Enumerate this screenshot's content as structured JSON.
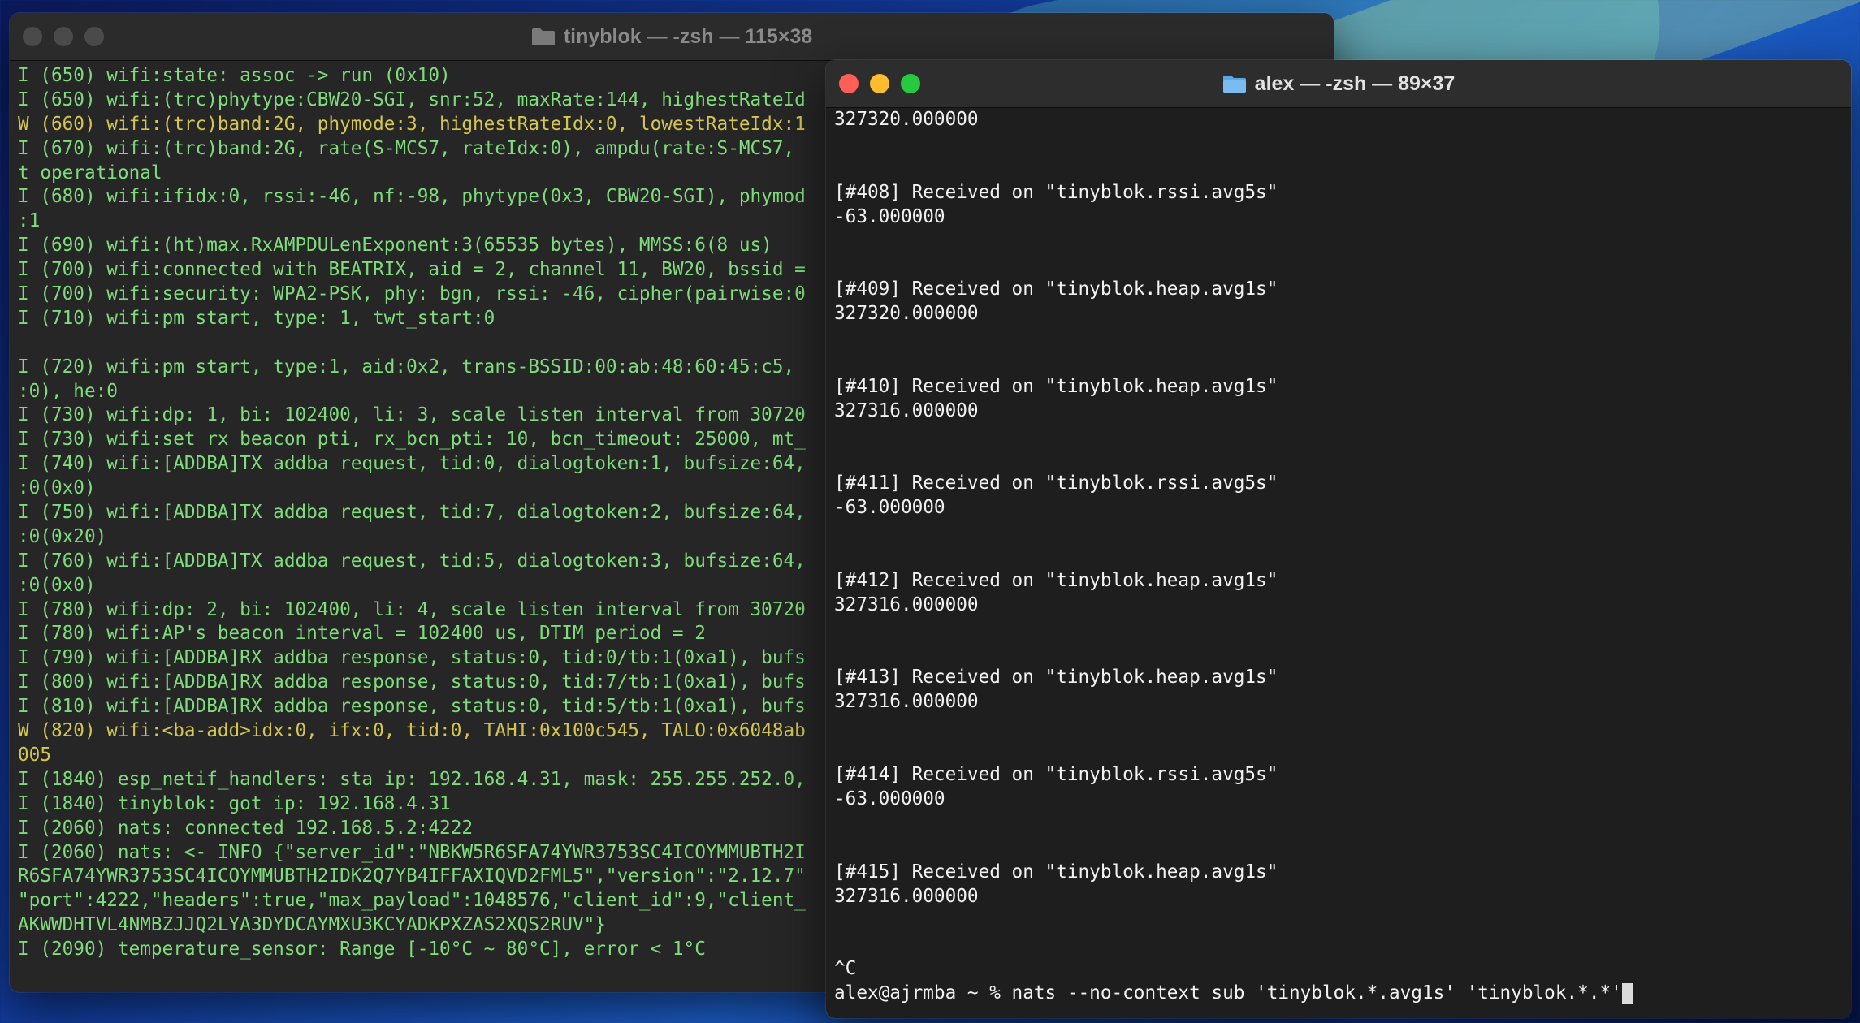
{
  "left_window": {
    "title": "tinyblok — -zsh — 115×38",
    "lines": [
      {
        "text": "I (650) wifi:state: assoc -> run (0x10)",
        "level": "I"
      },
      {
        "text": "I (650) wifi:(trc)phytype:CBW20-SGI, snr:52, maxRate:144, highestRateId",
        "level": "I"
      },
      {
        "text": "W (660) wifi:(trc)band:2G, phymode:3, highestRateIdx:0, lowestRateIdx:1",
        "level": "W"
      },
      {
        "text": "I (670) wifi:(trc)band:2G, rate(S-MCS7, rateIdx:0), ampdu(rate:S-MCS7,",
        "level": "I"
      },
      {
        "text": "t operational",
        "level": "I"
      },
      {
        "text": "I (680) wifi:ifidx:0, rssi:-46, nf:-98, phytype(0x3, CBW20-SGI), phymod",
        "level": "I"
      },
      {
        "text": ":1",
        "level": "I"
      },
      {
        "text": "I (690) wifi:(ht)max.RxAMPDULenExponent:3(65535 bytes), MMSS:6(8 us)",
        "level": "I"
      },
      {
        "text": "I (700) wifi:connected with BEATRIX, aid = 2, channel 11, BW20, bssid =",
        "level": "I"
      },
      {
        "text": "I (700) wifi:security: WPA2-PSK, phy: bgn, rssi: -46, cipher(pairwise:0",
        "level": "I"
      },
      {
        "text": "I (710) wifi:pm start, type: 1, twt_start:0",
        "level": "I"
      },
      {
        "text": "",
        "level": "I"
      },
      {
        "text": "I (720) wifi:pm start, type:1, aid:0x2, trans-BSSID:00:ab:48:60:45:c5,",
        "level": "I"
      },
      {
        "text": ":0), he:0",
        "level": "I"
      },
      {
        "text": "I (730) wifi:dp: 1, bi: 102400, li: 3, scale listen interval from 30720",
        "level": "I"
      },
      {
        "text": "I (730) wifi:set rx beacon pti, rx_bcn_pti: 10, bcn_timeout: 25000, mt_",
        "level": "I"
      },
      {
        "text": "I (740) wifi:[ADDBA]TX addba request, tid:0, dialogtoken:1, bufsize:64,",
        "level": "I"
      },
      {
        "text": ":0(0x0)",
        "level": "I"
      },
      {
        "text": "I (750) wifi:[ADDBA]TX addba request, tid:7, dialogtoken:2, bufsize:64,",
        "level": "I"
      },
      {
        "text": ":0(0x20)",
        "level": "I"
      },
      {
        "text": "I (760) wifi:[ADDBA]TX addba request, tid:5, dialogtoken:3, bufsize:64,",
        "level": "I"
      },
      {
        "text": ":0(0x0)",
        "level": "I"
      },
      {
        "text": "I (780) wifi:dp: 2, bi: 102400, li: 4, scale listen interval from 30720",
        "level": "I"
      },
      {
        "text": "I (780) wifi:AP's beacon interval = 102400 us, DTIM period = 2",
        "level": "I"
      },
      {
        "text": "I (790) wifi:[ADDBA]RX addba response, status:0, tid:0/tb:1(0xa1), bufs",
        "level": "I"
      },
      {
        "text": "I (800) wifi:[ADDBA]RX addba response, status:0, tid:7/tb:1(0xa1), bufs",
        "level": "I"
      },
      {
        "text": "I (810) wifi:[ADDBA]RX addba response, status:0, tid:5/tb:1(0xa1), bufs",
        "level": "I"
      },
      {
        "text": "W (820) wifi:<ba-add>idx:0, ifx:0, tid:0, TAHI:0x100c545, TALO:0x6048ab",
        "level": "W"
      },
      {
        "text": "005",
        "level": "W"
      },
      {
        "text": "I (1840) esp_netif_handlers: sta ip: 192.168.4.31, mask: 255.255.252.0,",
        "level": "I"
      },
      {
        "text": "I (1840) tinyblok: got ip: 192.168.4.31",
        "level": "I"
      },
      {
        "text": "I (2060) nats: connected 192.168.5.2:4222",
        "level": "I"
      },
      {
        "text": "I (2060) nats: <- INFO {\"server_id\":\"NBKW5R6SFA74YWR3753SC4ICOYMMUBTH2I",
        "level": "I"
      },
      {
        "text": "R6SFA74YWR3753SC4ICOYMMUBTH2IDK2Q7YB4IFFAXIQVD2FML5\",\"version\":\"2.12.7\"",
        "level": "I"
      },
      {
        "text": "\"port\":4222,\"headers\":true,\"max_payload\":1048576,\"client_id\":9,\"client_",
        "level": "I"
      },
      {
        "text": "AKWWDHTVL4NMBZJJQ2LYA3DYDCAYMXU3KCYADKPXZAS2XQS2RUV\"}",
        "level": "I"
      },
      {
        "text": "I (2090) temperature_sensor: Range [-10°C ~ 80°C], error < 1°C",
        "level": "I"
      }
    ]
  },
  "right_window": {
    "title": "alex — -zsh — 89×37",
    "lines": [
      "327320.000000",
      "",
      "",
      "[#408] Received on \"tinyblok.rssi.avg5s\"",
      "-63.000000",
      "",
      "",
      "[#409] Received on \"tinyblok.heap.avg1s\"",
      "327320.000000",
      "",
      "",
      "[#410] Received on \"tinyblok.heap.avg1s\"",
      "327316.000000",
      "",
      "",
      "[#411] Received on \"tinyblok.rssi.avg5s\"",
      "-63.000000",
      "",
      "",
      "[#412] Received on \"tinyblok.heap.avg1s\"",
      "327316.000000",
      "",
      "",
      "[#413] Received on \"tinyblok.heap.avg1s\"",
      "327316.000000",
      "",
      "",
      "[#414] Received on \"tinyblok.rssi.avg5s\"",
      "-63.000000",
      "",
      "",
      "[#415] Received on \"tinyblok.heap.avg1s\"",
      "327316.000000",
      "",
      "",
      "^C"
    ],
    "prompt": "alex@ajrmba ~ % nats --no-context sub 'tinyblok.*.avg1s' 'tinyblok.*.*'"
  },
  "colors": {
    "info": "#7fdc7c",
    "warn": "#d4c64f",
    "close": "#ff5f57",
    "minimize": "#febc2e",
    "maximize": "#28c840",
    "folder": "#5aa7e8"
  }
}
